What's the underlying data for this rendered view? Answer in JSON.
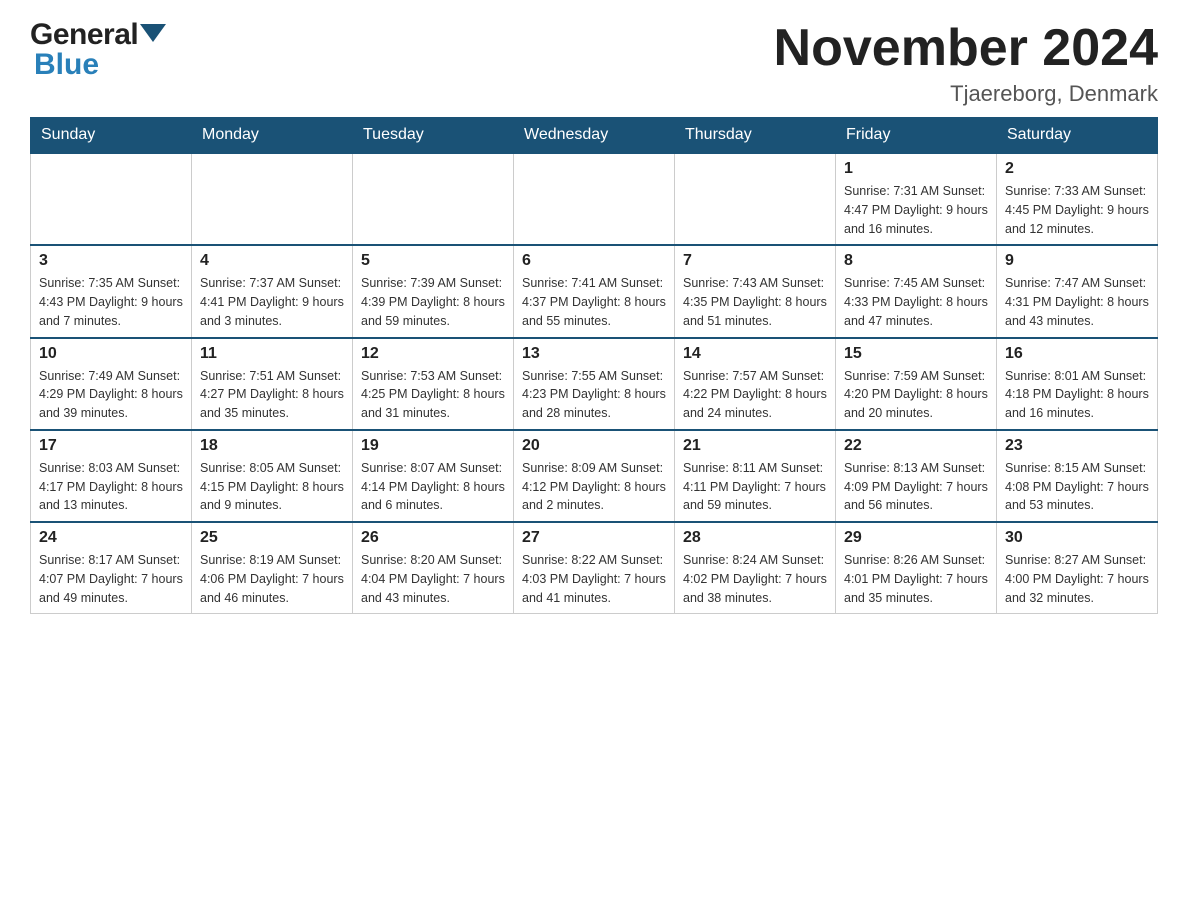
{
  "header": {
    "logo_general": "General",
    "logo_blue": "Blue",
    "month_title": "November 2024",
    "location": "Tjaereborg, Denmark"
  },
  "days_of_week": [
    "Sunday",
    "Monday",
    "Tuesday",
    "Wednesday",
    "Thursday",
    "Friday",
    "Saturday"
  ],
  "weeks": [
    [
      {
        "day": "",
        "info": ""
      },
      {
        "day": "",
        "info": ""
      },
      {
        "day": "",
        "info": ""
      },
      {
        "day": "",
        "info": ""
      },
      {
        "day": "",
        "info": ""
      },
      {
        "day": "1",
        "info": "Sunrise: 7:31 AM\nSunset: 4:47 PM\nDaylight: 9 hours\nand 16 minutes."
      },
      {
        "day": "2",
        "info": "Sunrise: 7:33 AM\nSunset: 4:45 PM\nDaylight: 9 hours\nand 12 minutes."
      }
    ],
    [
      {
        "day": "3",
        "info": "Sunrise: 7:35 AM\nSunset: 4:43 PM\nDaylight: 9 hours\nand 7 minutes."
      },
      {
        "day": "4",
        "info": "Sunrise: 7:37 AM\nSunset: 4:41 PM\nDaylight: 9 hours\nand 3 minutes."
      },
      {
        "day": "5",
        "info": "Sunrise: 7:39 AM\nSunset: 4:39 PM\nDaylight: 8 hours\nand 59 minutes."
      },
      {
        "day": "6",
        "info": "Sunrise: 7:41 AM\nSunset: 4:37 PM\nDaylight: 8 hours\nand 55 minutes."
      },
      {
        "day": "7",
        "info": "Sunrise: 7:43 AM\nSunset: 4:35 PM\nDaylight: 8 hours\nand 51 minutes."
      },
      {
        "day": "8",
        "info": "Sunrise: 7:45 AM\nSunset: 4:33 PM\nDaylight: 8 hours\nand 47 minutes."
      },
      {
        "day": "9",
        "info": "Sunrise: 7:47 AM\nSunset: 4:31 PM\nDaylight: 8 hours\nand 43 minutes."
      }
    ],
    [
      {
        "day": "10",
        "info": "Sunrise: 7:49 AM\nSunset: 4:29 PM\nDaylight: 8 hours\nand 39 minutes."
      },
      {
        "day": "11",
        "info": "Sunrise: 7:51 AM\nSunset: 4:27 PM\nDaylight: 8 hours\nand 35 minutes."
      },
      {
        "day": "12",
        "info": "Sunrise: 7:53 AM\nSunset: 4:25 PM\nDaylight: 8 hours\nand 31 minutes."
      },
      {
        "day": "13",
        "info": "Sunrise: 7:55 AM\nSunset: 4:23 PM\nDaylight: 8 hours\nand 28 minutes."
      },
      {
        "day": "14",
        "info": "Sunrise: 7:57 AM\nSunset: 4:22 PM\nDaylight: 8 hours\nand 24 minutes."
      },
      {
        "day": "15",
        "info": "Sunrise: 7:59 AM\nSunset: 4:20 PM\nDaylight: 8 hours\nand 20 minutes."
      },
      {
        "day": "16",
        "info": "Sunrise: 8:01 AM\nSunset: 4:18 PM\nDaylight: 8 hours\nand 16 minutes."
      }
    ],
    [
      {
        "day": "17",
        "info": "Sunrise: 8:03 AM\nSunset: 4:17 PM\nDaylight: 8 hours\nand 13 minutes."
      },
      {
        "day": "18",
        "info": "Sunrise: 8:05 AM\nSunset: 4:15 PM\nDaylight: 8 hours\nand 9 minutes."
      },
      {
        "day": "19",
        "info": "Sunrise: 8:07 AM\nSunset: 4:14 PM\nDaylight: 8 hours\nand 6 minutes."
      },
      {
        "day": "20",
        "info": "Sunrise: 8:09 AM\nSunset: 4:12 PM\nDaylight: 8 hours\nand 2 minutes."
      },
      {
        "day": "21",
        "info": "Sunrise: 8:11 AM\nSunset: 4:11 PM\nDaylight: 7 hours\nand 59 minutes."
      },
      {
        "day": "22",
        "info": "Sunrise: 8:13 AM\nSunset: 4:09 PM\nDaylight: 7 hours\nand 56 minutes."
      },
      {
        "day": "23",
        "info": "Sunrise: 8:15 AM\nSunset: 4:08 PM\nDaylight: 7 hours\nand 53 minutes."
      }
    ],
    [
      {
        "day": "24",
        "info": "Sunrise: 8:17 AM\nSunset: 4:07 PM\nDaylight: 7 hours\nand 49 minutes."
      },
      {
        "day": "25",
        "info": "Sunrise: 8:19 AM\nSunset: 4:06 PM\nDaylight: 7 hours\nand 46 minutes."
      },
      {
        "day": "26",
        "info": "Sunrise: 8:20 AM\nSunset: 4:04 PM\nDaylight: 7 hours\nand 43 minutes."
      },
      {
        "day": "27",
        "info": "Sunrise: 8:22 AM\nSunset: 4:03 PM\nDaylight: 7 hours\nand 41 minutes."
      },
      {
        "day": "28",
        "info": "Sunrise: 8:24 AM\nSunset: 4:02 PM\nDaylight: 7 hours\nand 38 minutes."
      },
      {
        "day": "29",
        "info": "Sunrise: 8:26 AM\nSunset: 4:01 PM\nDaylight: 7 hours\nand 35 minutes."
      },
      {
        "day": "30",
        "info": "Sunrise: 8:27 AM\nSunset: 4:00 PM\nDaylight: 7 hours\nand 32 minutes."
      }
    ]
  ]
}
